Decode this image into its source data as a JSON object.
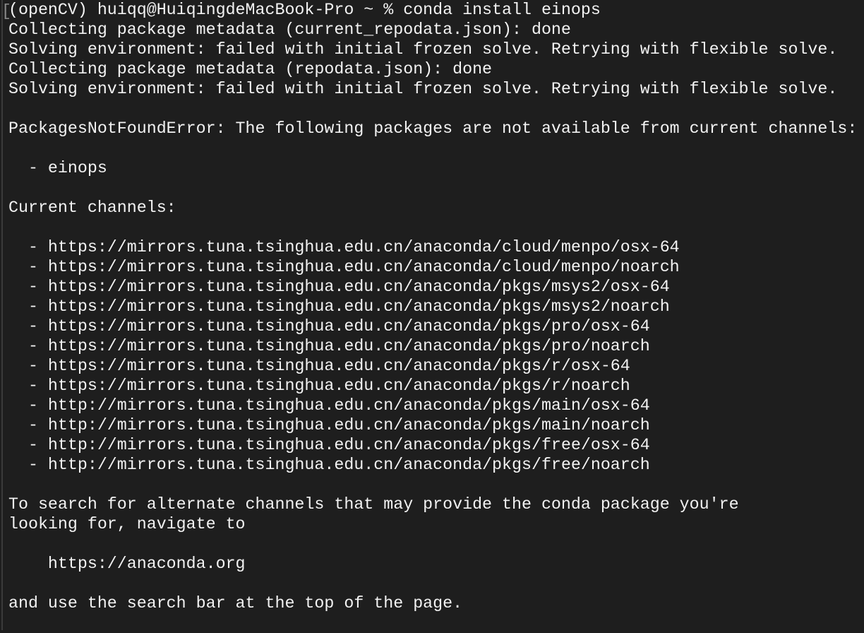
{
  "terminal": {
    "mark_glyph": "[",
    "lines": [
      "(openCV) huiqq@HuiqingdeMacBook-Pro ~ % conda install einops",
      "Collecting package metadata (current_repodata.json): done",
      "Solving environment: failed with initial frozen solve. Retrying with flexible solve.",
      "Collecting package metadata (repodata.json): done",
      "Solving environment: failed with initial frozen solve. Retrying with flexible solve.",
      "",
      "PackagesNotFoundError: The following packages are not available from current channels:",
      "",
      "  - einops",
      "",
      "Current channels:",
      "",
      "  - https://mirrors.tuna.tsinghua.edu.cn/anaconda/cloud/menpo/osx-64",
      "  - https://mirrors.tuna.tsinghua.edu.cn/anaconda/cloud/menpo/noarch",
      "  - https://mirrors.tuna.tsinghua.edu.cn/anaconda/pkgs/msys2/osx-64",
      "  - https://mirrors.tuna.tsinghua.edu.cn/anaconda/pkgs/msys2/noarch",
      "  - https://mirrors.tuna.tsinghua.edu.cn/anaconda/pkgs/pro/osx-64",
      "  - https://mirrors.tuna.tsinghua.edu.cn/anaconda/pkgs/pro/noarch",
      "  - https://mirrors.tuna.tsinghua.edu.cn/anaconda/pkgs/r/osx-64",
      "  - https://mirrors.tuna.tsinghua.edu.cn/anaconda/pkgs/r/noarch",
      "  - http://mirrors.tuna.tsinghua.edu.cn/anaconda/pkgs/main/osx-64",
      "  - http://mirrors.tuna.tsinghua.edu.cn/anaconda/pkgs/main/noarch",
      "  - http://mirrors.tuna.tsinghua.edu.cn/anaconda/pkgs/free/osx-64",
      "  - http://mirrors.tuna.tsinghua.edu.cn/anaconda/pkgs/free/noarch",
      "",
      "To search for alternate channels that may provide the conda package you're",
      "looking for, navigate to",
      "",
      "    https://anaconda.org",
      "",
      "and use the search bar at the top of the page.",
      ""
    ]
  }
}
